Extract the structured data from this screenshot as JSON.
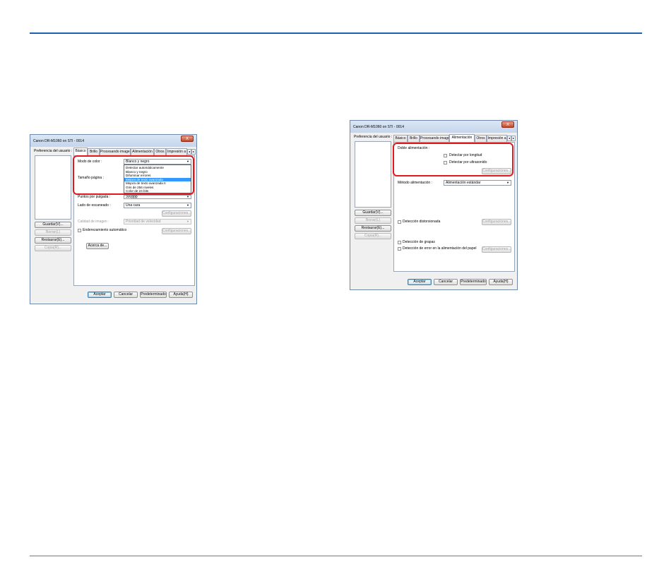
{
  "left_dialog": {
    "title": "Canon DR-M1060 on STI - 0014",
    "close": "X",
    "user_pref_label": "Preferencia del usuario :",
    "side_buttons": [
      "Guardar(V)...",
      "Borrar(L)",
      "Restaurar(E)...",
      "Copia(R)..."
    ],
    "tabs": [
      "Básico",
      "Brillo",
      "Procesando imagen",
      "Alimentación",
      "Otros",
      "Impresión a"
    ],
    "tab_arrows": [
      "◂",
      "▸"
    ],
    "modo_color_label": "Modo de color :",
    "modo_color_value": "Blanco y negro",
    "dropdown_items": [
      "Detectar automáticamente",
      "Blanco y negro",
      "Difuminar errores",
      "Mejora de texto avanzada",
      "Mejora de texto avanzada II",
      "Gris de 256 niveles",
      "Color de 24 bits"
    ],
    "tamano_label": "Tamaño página :",
    "ppp_label": "Puntos por pulgada :",
    "ppp_value": "300ppp",
    "lado_label": "Lado de escaneado :",
    "lado_value": "Una cara",
    "config1": "Configuraciones...",
    "calidad_label": "Calidad de imagen :",
    "calidad_value": "Prioridad de velocidad",
    "enderezamiento_label": "Enderezamiento automático",
    "config2": "Configuraciones...",
    "acerca": "Acerca de...",
    "bottom_buttons": [
      "Aceptar",
      "Cancelar",
      "Predeterminado",
      "Ayuda(H)"
    ]
  },
  "right_dialog": {
    "title": "Canon DR-M1060 on STI - 0014",
    "close": "X",
    "user_pref_label": "Preferencia del usuario :",
    "side_buttons": [
      "Guardar(V)...",
      "Borrar(L)",
      "Restaurar(E)...",
      "Copia(R)..."
    ],
    "tabs": [
      "Básico",
      "Brillo",
      "Procesando imagen",
      "Alimentación",
      "Otros",
      "Impresión a"
    ],
    "tab_arrows": [
      "◂",
      "▸"
    ],
    "doble_label": "Doble alimentación :",
    "detectar_longitud": "Detectar por longitud",
    "detectar_ultrasonido": "Detectar por ultrasonido",
    "config_doble": "Configuraciones...",
    "metodo_label": "Método alimentación :",
    "metodo_value": "Alimentación estándar",
    "deteccion_distorsionada": "Detección distorsionada",
    "config_distorsion": "Configuraciones...",
    "deteccion_grapas": "Detección de grapas",
    "deteccion_error": "Detección de error en la alimentación del papel",
    "config_error": "Configuraciones...",
    "bottom_buttons": [
      "Aceptar",
      "Cancelar",
      "Predeterminado",
      "Ayuda(H)"
    ]
  }
}
